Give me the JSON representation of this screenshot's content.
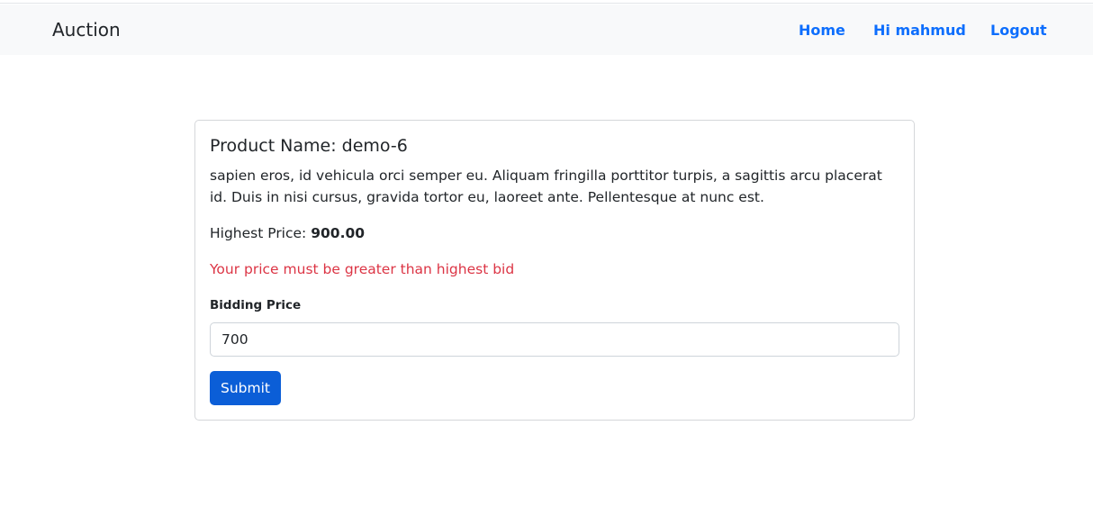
{
  "navbar": {
    "brand": "Auction",
    "links": [
      {
        "label": "Home"
      },
      {
        "label": "Hi mahmud"
      },
      {
        "label": "Logout"
      }
    ],
    "link_color": "#0d6efd"
  },
  "product": {
    "title": "Product Name: demo-6",
    "description": "sapien eros, id vehicula orci semper eu. Aliquam fringilla porttitor turpis, a sagittis arcu placerat id. Duis in nisi cursus, gravida tortor eu, laoreet ante. Pellentesque at nunc est.",
    "highest_price_label": "Highest Price:",
    "highest_price_value": "900.00"
  },
  "form": {
    "error_message": "Your price must be greater than highest bid",
    "error_color": "#dc3545",
    "bid_label": "Bidding Price",
    "bid_value": "700",
    "submit_label": "Submit",
    "submit_color": "#0b5ed7"
  }
}
